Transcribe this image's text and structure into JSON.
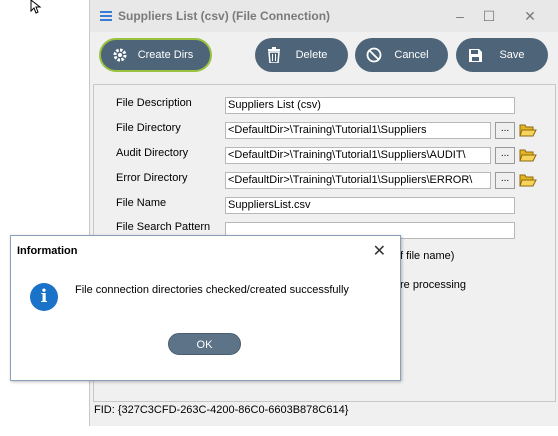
{
  "window": {
    "title": "Suppliers List (csv) (File Connection)",
    "minimize": "–",
    "maximize": "☐",
    "close": "✕"
  },
  "toolbar": {
    "create_dirs": "Create Dirs",
    "delete": "Delete",
    "cancel": "Cancel",
    "save": "Save"
  },
  "form": {
    "file_description_label": "File Description",
    "file_description_value": "Suppliers List (csv)",
    "file_directory_label": "File Directory",
    "file_directory_value": "<DefaultDir>\\Training\\Tutorial1\\Suppliers",
    "audit_directory_label": "Audit Directory",
    "audit_directory_value": "<DefaultDir>\\Training\\Tutorial1\\Suppliers\\AUDIT\\",
    "error_directory_label": "Error Directory",
    "error_directory_value": "<DefaultDir>\\Training\\Tutorial1\\Suppliers\\ERROR\\",
    "file_name_label": "File Name",
    "file_name_value": "SuppliersList.csv",
    "file_search_pattern_label": "File Search Pattern",
    "file_search_pattern_value": "",
    "browse_label": "...",
    "partial_text_1": "f file name)",
    "partial_text_2": "re processing"
  },
  "fid": "FID: {327C3CFD-263C-4200-86C0-6603B878C614}",
  "dialog": {
    "title": "Information",
    "close": "✕",
    "icon_glyph": "i",
    "message": "File connection directories checked/created successfully",
    "ok_label": "OK"
  }
}
